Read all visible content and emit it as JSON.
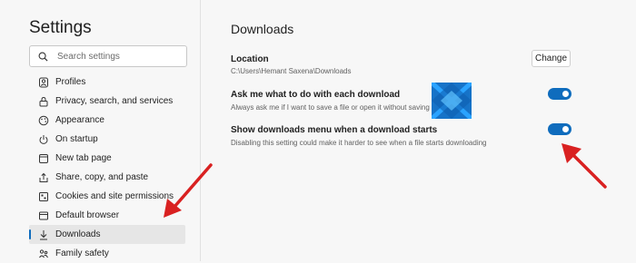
{
  "sidebar": {
    "title": "Settings",
    "search_placeholder": "Search settings",
    "items": [
      {
        "label": "Profiles",
        "icon": "profile-icon"
      },
      {
        "label": "Privacy, search, and services",
        "icon": "lock-icon"
      },
      {
        "label": "Appearance",
        "icon": "appearance-icon"
      },
      {
        "label": "On startup",
        "icon": "power-icon"
      },
      {
        "label": "New tab page",
        "icon": "new-tab-icon"
      },
      {
        "label": "Share, copy, and paste",
        "icon": "share-icon"
      },
      {
        "label": "Cookies and site permissions",
        "icon": "cookies-icon"
      },
      {
        "label": "Default browser",
        "icon": "browser-icon"
      },
      {
        "label": "Downloads",
        "icon": "download-icon",
        "active": true
      },
      {
        "label": "Family safety",
        "icon": "family-icon"
      }
    ]
  },
  "main": {
    "title": "Downloads",
    "location": {
      "title": "Location",
      "path": "C:\\Users\\Hemant Saxena\\Downloads",
      "button": "Change"
    },
    "ask": {
      "title": "Ask me what to do with each download",
      "subtitle": "Always ask me if I want to save a file or open it without saving",
      "enabled": true
    },
    "show_menu": {
      "title": "Show downloads menu when a download starts",
      "subtitle": "Disabling this setting could make it harder to see when a file starts downloading",
      "enabled": true
    }
  },
  "colors": {
    "accent": "#0f6cbd",
    "arrow": "#d92121",
    "logo_blue": "#1673c8"
  }
}
